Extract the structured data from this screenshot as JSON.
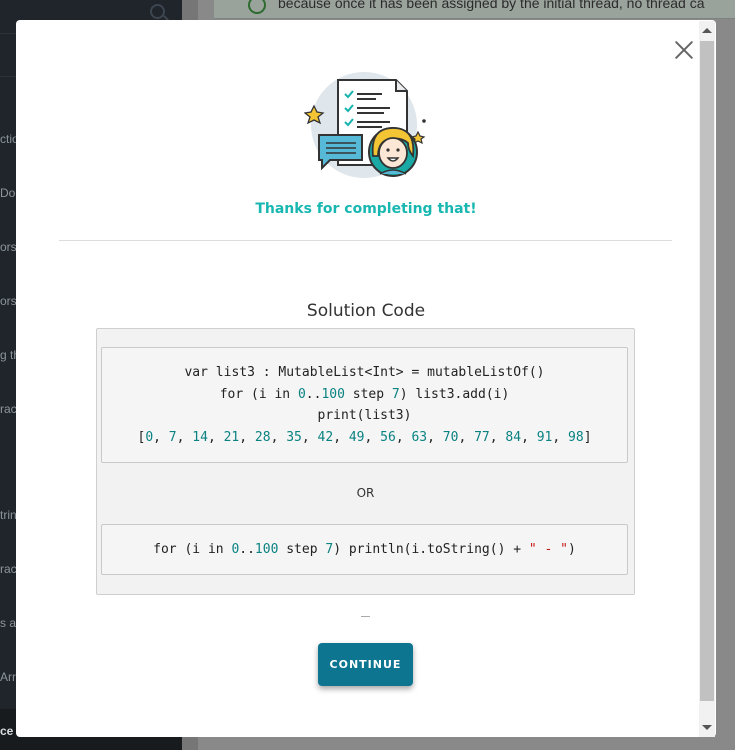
{
  "background": {
    "banner_text": "because once it has been assigned by the initial thread, no thread ca",
    "sidebar_items": [
      {
        "label": "ctio"
      },
      {
        "label": "Doc"
      },
      {
        "label": "ors"
      },
      {
        "label": "ors"
      },
      {
        "label": "g th"
      },
      {
        "label": "rac"
      },
      {
        "label": "trin"
      },
      {
        "label": "rac"
      },
      {
        "label": "s an"
      },
      {
        "label": "Arr"
      },
      {
        "label": "ce"
      }
    ]
  },
  "modal": {
    "thanks_text": "Thanks for completing that!",
    "solution_title": "Solution Code",
    "or_text": "OR",
    "continue_label": "CONTINUE",
    "code1": [
      "var list3 : MutableList<Int> = mutableListOf()",
      "for (i in 0..100 step 7) list3.add(i)",
      "print(list3)",
      "[0, 7, 14, 21, 28, 35, 42, 49, 56, 63, 70, 77, 84, 91, 98]"
    ],
    "code2": "for (i in 0..100 step 7) println(i.toString() + \" - \")"
  },
  "colors": {
    "accent": "#18b7b1",
    "button": "#0e7591",
    "code_number": "#0b8282",
    "code_string": "#c41a16"
  },
  "icons": [
    "search-icon",
    "check-circle-icon",
    "close-icon",
    "success-illustration"
  ]
}
